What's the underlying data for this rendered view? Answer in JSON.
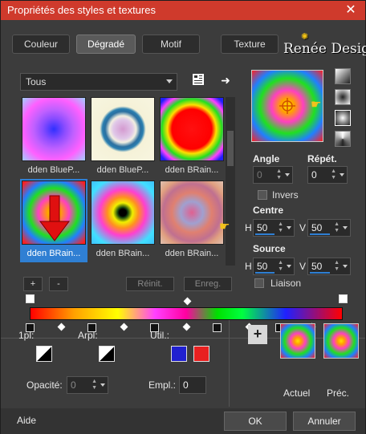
{
  "window": {
    "title": "Propriétés des styles et textures",
    "close": "✕"
  },
  "tabs": [
    {
      "label": "Couleur"
    },
    {
      "label": "Dégradé"
    },
    {
      "label": "Motif"
    },
    {
      "label": "Texture"
    }
  ],
  "brand": "Renée Design",
  "library": {
    "category": "Tous",
    "swatches": [
      {
        "label": "dden BlueP..."
      },
      {
        "label": "dden BlueP..."
      },
      {
        "label": "dden BRain..."
      },
      {
        "label": "dden BRain..."
      },
      {
        "label": "dden BRain..."
      },
      {
        "label": "dden BRain..."
      }
    ],
    "selected_index": 3,
    "add": "+",
    "remove": "-",
    "reset": "Réinit.",
    "save": "Enreg."
  },
  "properties": {
    "angle_label": "Angle",
    "angle_value": "0",
    "repeat_label": "Répét.",
    "repeat_value": "0",
    "invert_label": "Invers",
    "center_label": "Centre",
    "center_h": "50",
    "center_v": "50",
    "source_label": "Source",
    "source_h": "50",
    "source_v": "50",
    "link_label": "Liaison",
    "h": "H",
    "v": "V"
  },
  "bottom": {
    "first_plane": "1pl:",
    "back_plane": "Arpl:",
    "use": "Util.:",
    "opacity_label": "Opacité:",
    "opacity_value": "0",
    "location_label": "Empl.:",
    "location_value": "0",
    "current": "Actuel",
    "previous": "Préc."
  },
  "footer": {
    "help": "Aide",
    "ok": "OK",
    "cancel": "Annuler"
  },
  "colors": {
    "use_left": "#2020d0",
    "use_right": "#e82020",
    "accent": "#2f7fd3",
    "title_bar": "#cf3a2c"
  }
}
